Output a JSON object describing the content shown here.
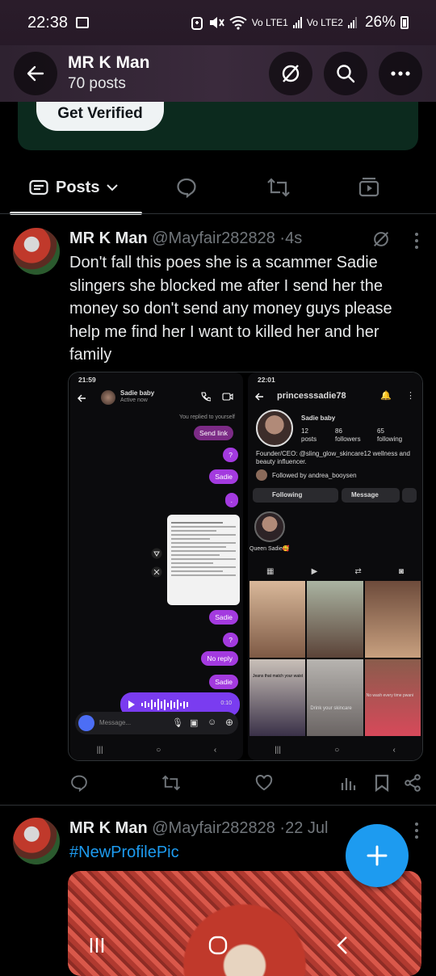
{
  "status_bar": {
    "time": "22:38",
    "lte1": "Vo LTE1",
    "lte2": "Vo LTE2",
    "battery": "26%"
  },
  "header": {
    "title": "MR K Man",
    "subtitle": "70 posts"
  },
  "banner": {
    "verify_label": "Get Verified"
  },
  "tabs": {
    "posts_label": "Posts"
  },
  "tweets": [
    {
      "name": "MR K Man",
      "handle": "@Mayfair282828",
      "time": "4s",
      "text": "Don't fall this poes she is a scammer  Sadie slingers she blocked me after I send her the money so don't send any money guys please help me find her I want to killed her and her family"
    },
    {
      "name": "MR K Man",
      "handle": "@Mayfair282828",
      "time": "22 Jul",
      "text": "#NewProfilePic"
    }
  ],
  "chat_shot": {
    "time": "21:59",
    "contact": "Sadie baby",
    "presence": "Active now",
    "replied": "You replied to yourself",
    "messages": [
      "Send link",
      "?",
      "Sadie",
      ".",
      "Sadie",
      "?",
      "No reply",
      "Sadie"
    ],
    "audio_time": "0:10",
    "composer_placeholder": "Message..."
  },
  "profile_shot": {
    "time": "22:01",
    "username": "princesssadie78",
    "display_name": "Sadie baby",
    "posts_count": "12",
    "posts_label": "posts",
    "followers_count": "86",
    "followers_label": "followers",
    "following_count": "65",
    "following_label": "following",
    "bio": "Founder/CEO: @sling_glow_skincare12 wellness and beauty influencer.",
    "followed_by": "Followed by andrea_booysen",
    "following_btn": "Following",
    "message_btn": "Message",
    "highlight": "Queen Sadie🥰",
    "grid_captions": [
      "Jeans that match your waist",
      "Drink your skincare",
      "No wash every time pwani"
    ]
  },
  "colors": {
    "accent": "#1d9bf0",
    "bubble": "#a33adf",
    "banner": "#0c2a1e"
  }
}
